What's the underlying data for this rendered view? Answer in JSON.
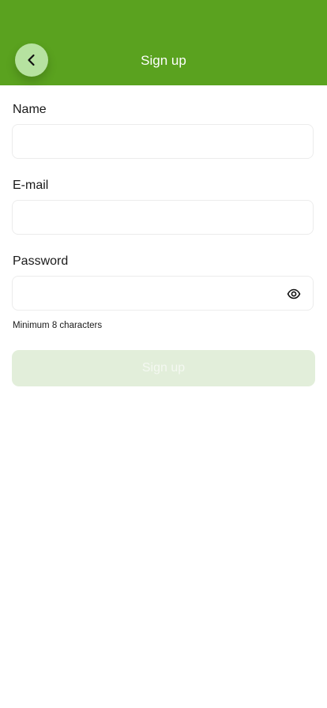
{
  "header": {
    "title": "Sign up",
    "back_icon": "chevron-left-icon",
    "background_color": "#5aa21f"
  },
  "form": {
    "name": {
      "label": "Name",
      "value": "",
      "placeholder": ""
    },
    "email": {
      "label": "E-mail",
      "value": "",
      "placeholder": ""
    },
    "password": {
      "label": "Password",
      "value": "",
      "placeholder": "",
      "hint": "Minimum 8 characters",
      "toggle_icon": "eye-icon"
    },
    "submit_label": "Sign up",
    "submit_disabled": true
  }
}
